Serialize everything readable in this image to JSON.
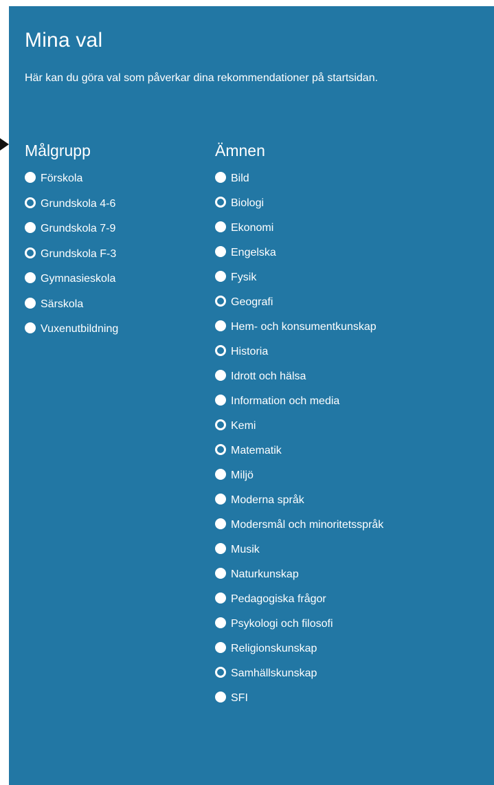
{
  "header": {
    "title": "Mina val",
    "intro": "Här kan du göra val som påverkar dina rekommendationer på startsidan."
  },
  "target_group": {
    "heading": "Målgrupp",
    "options": [
      {
        "label": "Förskola",
        "selected": true
      },
      {
        "label": "Grundskola 4-6",
        "selected": false
      },
      {
        "label": "Grundskola 7-9",
        "selected": true
      },
      {
        "label": "Grundskola F-3",
        "selected": false
      },
      {
        "label": "Gymnasieskola",
        "selected": true
      },
      {
        "label": "Särskola",
        "selected": true
      },
      {
        "label": "Vuxenutbildning",
        "selected": true
      }
    ]
  },
  "subjects": {
    "heading": "Ämnen",
    "options": [
      {
        "label": "Bild",
        "selected": true
      },
      {
        "label": "Biologi",
        "selected": false
      },
      {
        "label": "Ekonomi",
        "selected": true
      },
      {
        "label": "Engelska",
        "selected": true
      },
      {
        "label": "Fysik",
        "selected": true
      },
      {
        "label": "Geografi",
        "selected": false
      },
      {
        "label": "Hem- och konsumentkunskap",
        "selected": true
      },
      {
        "label": "Historia",
        "selected": false
      },
      {
        "label": "Idrott och hälsa",
        "selected": true
      },
      {
        "label": "Information och media",
        "selected": true
      },
      {
        "label": "Kemi",
        "selected": false
      },
      {
        "label": "Matematik",
        "selected": false
      },
      {
        "label": "Miljö",
        "selected": true
      },
      {
        "label": "Moderna språk",
        "selected": true
      },
      {
        "label": "Modersmål och minoritetsspråk",
        "selected": true
      },
      {
        "label": "Musik",
        "selected": true
      },
      {
        "label": "Naturkunskap",
        "selected": true
      },
      {
        "label": "Pedagogiska frågor",
        "selected": true
      },
      {
        "label": "Psykologi och filosofi",
        "selected": true
      },
      {
        "label": "Religionskunskap",
        "selected": true
      },
      {
        "label": "Samhällskunskap",
        "selected": false
      },
      {
        "label": "SFI",
        "selected": true
      }
    ]
  },
  "colors": {
    "panel_background": "#2277a4",
    "text": "#ffffff",
    "pointer": "#111111"
  },
  "icons": {
    "radio_selected": "filled-circle-icon",
    "radio_unselected": "ring-circle-icon",
    "pointer": "triangle-pointer-icon"
  }
}
